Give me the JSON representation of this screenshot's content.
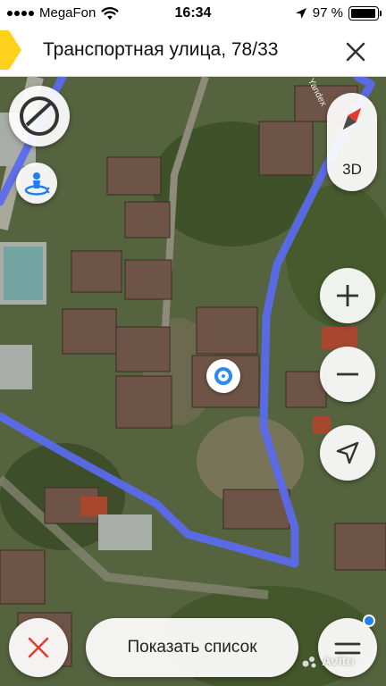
{
  "status_bar": {
    "carrier": "MegaFon",
    "time": "16:34",
    "battery_text": "97 %",
    "battery_level": 0.97
  },
  "title_bar": {
    "title": "Транспортная улица, 78/33",
    "close_icon": "close-icon"
  },
  "map": {
    "watermark_text": "Yandex",
    "route_color": "#5a6af0",
    "controls": {
      "layers": "layers-icon",
      "panorama": "panorama-icon",
      "compass": "compass-icon",
      "label_3d": "3D",
      "zoom_in": "plus-icon",
      "zoom_out": "minus-icon",
      "locate": "navigation-arrow-icon"
    },
    "user_location_color": "#2b8cf0"
  },
  "bottom_bar": {
    "cancel_icon": "close-icon",
    "show_list_label": "Показать список",
    "menu_icon": "hamburger-icon",
    "menu_badge_color": "#1e7ff0"
  },
  "watermark": {
    "text": "Avito"
  }
}
